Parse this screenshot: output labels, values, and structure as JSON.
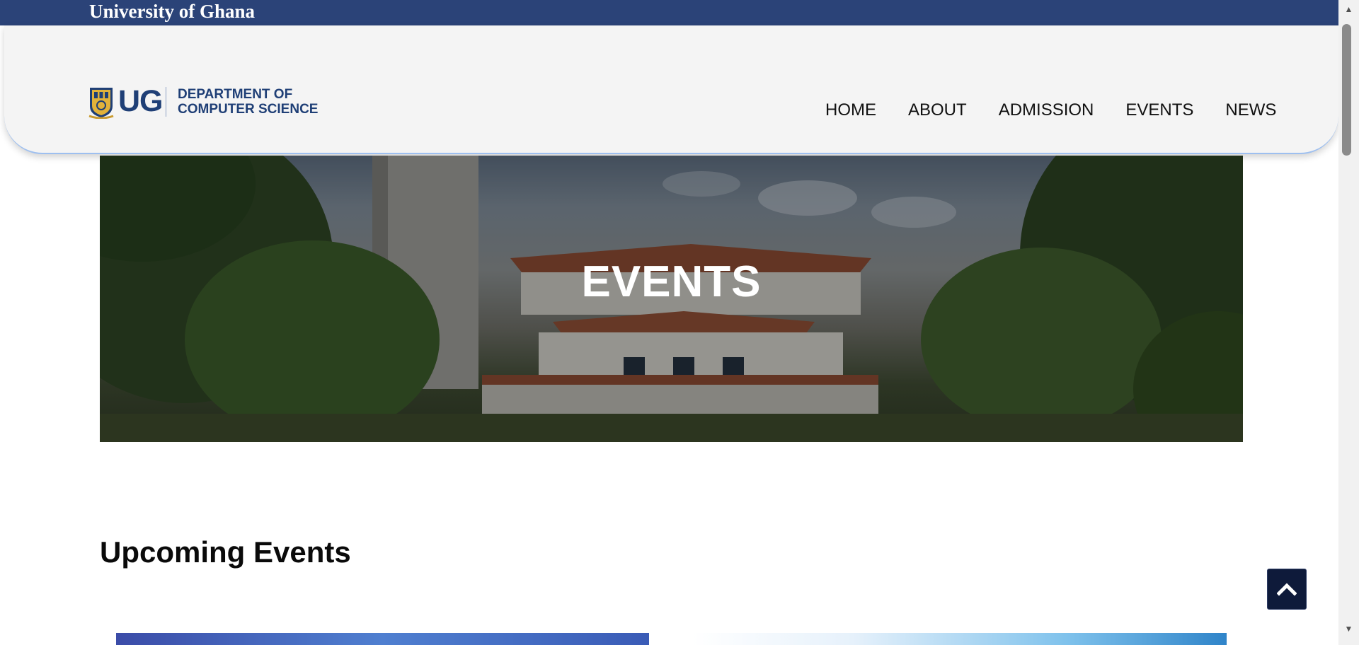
{
  "topbar": {
    "title": "University of Ghana"
  },
  "header": {
    "logo": {
      "abbrev": "UG",
      "department_line1": "DEPARTMENT OF",
      "department_line2": "COMPUTER SCIENCE"
    },
    "nav": [
      {
        "label": "HOME"
      },
      {
        "label": "ABOUT"
      },
      {
        "label": "ADMISSION"
      },
      {
        "label": "EVENTS"
      },
      {
        "label": "NEWS"
      }
    ]
  },
  "hero": {
    "title": "EVENTS"
  },
  "main": {
    "section_title": "Upcoming Events"
  },
  "icons": {
    "back_to_top": "chevron-up-icon",
    "crest": "university-crest-icon"
  },
  "colors": {
    "topbar": "#2b4378",
    "brand": "#1f3f76",
    "back_to_top": "#0e1a3a"
  }
}
